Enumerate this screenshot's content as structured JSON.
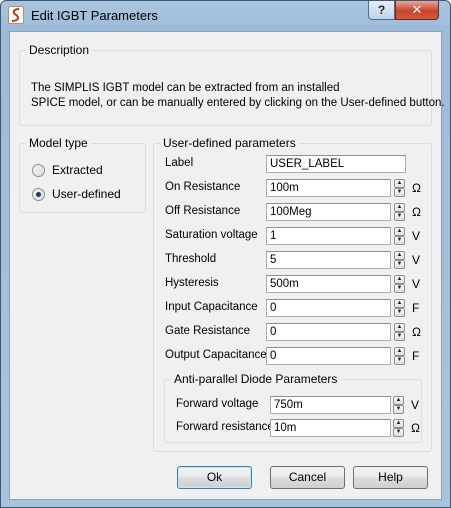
{
  "window": {
    "title": "Edit IGBT Parameters",
    "help_glyph": "?",
    "close_glyph": "✕"
  },
  "description": {
    "title": "Description",
    "line1": "The SIMPLIS IGBT model can be extracted from an installed",
    "line2": "SPICE model, or can be manually entered by clicking on the User-defined button."
  },
  "model_type": {
    "title": "Model type",
    "options": [
      {
        "label": "Extracted",
        "checked": false
      },
      {
        "label": "User-defined",
        "checked": true
      }
    ]
  },
  "user_params": {
    "title": "User-defined parameters",
    "label_field": {
      "label": "Label",
      "value": "USER_LABEL"
    },
    "rows": [
      {
        "label": "On Resistance",
        "value": "100m",
        "unit": "Ω"
      },
      {
        "label": "Off Resistance",
        "value": "100Meg",
        "unit": "Ω"
      },
      {
        "label": "Saturation voltage",
        "value": "1",
        "unit": "V"
      },
      {
        "label": "Threshold",
        "value": "5",
        "unit": "V"
      },
      {
        "label": "Hysteresis",
        "value": "500m",
        "unit": "V"
      },
      {
        "label": "Input Capacitance",
        "value": "0",
        "unit": "F"
      },
      {
        "label": "Gate Resistance",
        "value": "0",
        "unit": "Ω"
      },
      {
        "label": "Output Capacitance",
        "value": "0",
        "unit": "F"
      }
    ]
  },
  "diode": {
    "title": "Anti-parallel Diode Parameters",
    "rows": [
      {
        "label": "Forward voltage",
        "value": "750m",
        "unit": "V"
      },
      {
        "label": "Forward resistance",
        "value": "10m",
        "unit": "Ω"
      }
    ]
  },
  "buttons": {
    "ok": "Ok",
    "cancel": "Cancel",
    "help": "Help"
  },
  "icons": {
    "app": "simplis-app-icon",
    "spin_up": "▲",
    "spin_down": "▼"
  },
  "colors": {
    "title_bar": "#a9c5e0",
    "close_button": "#c8432c",
    "dialog_bg": "#f0f0f0",
    "default_button_border": "#3c7fb1"
  }
}
